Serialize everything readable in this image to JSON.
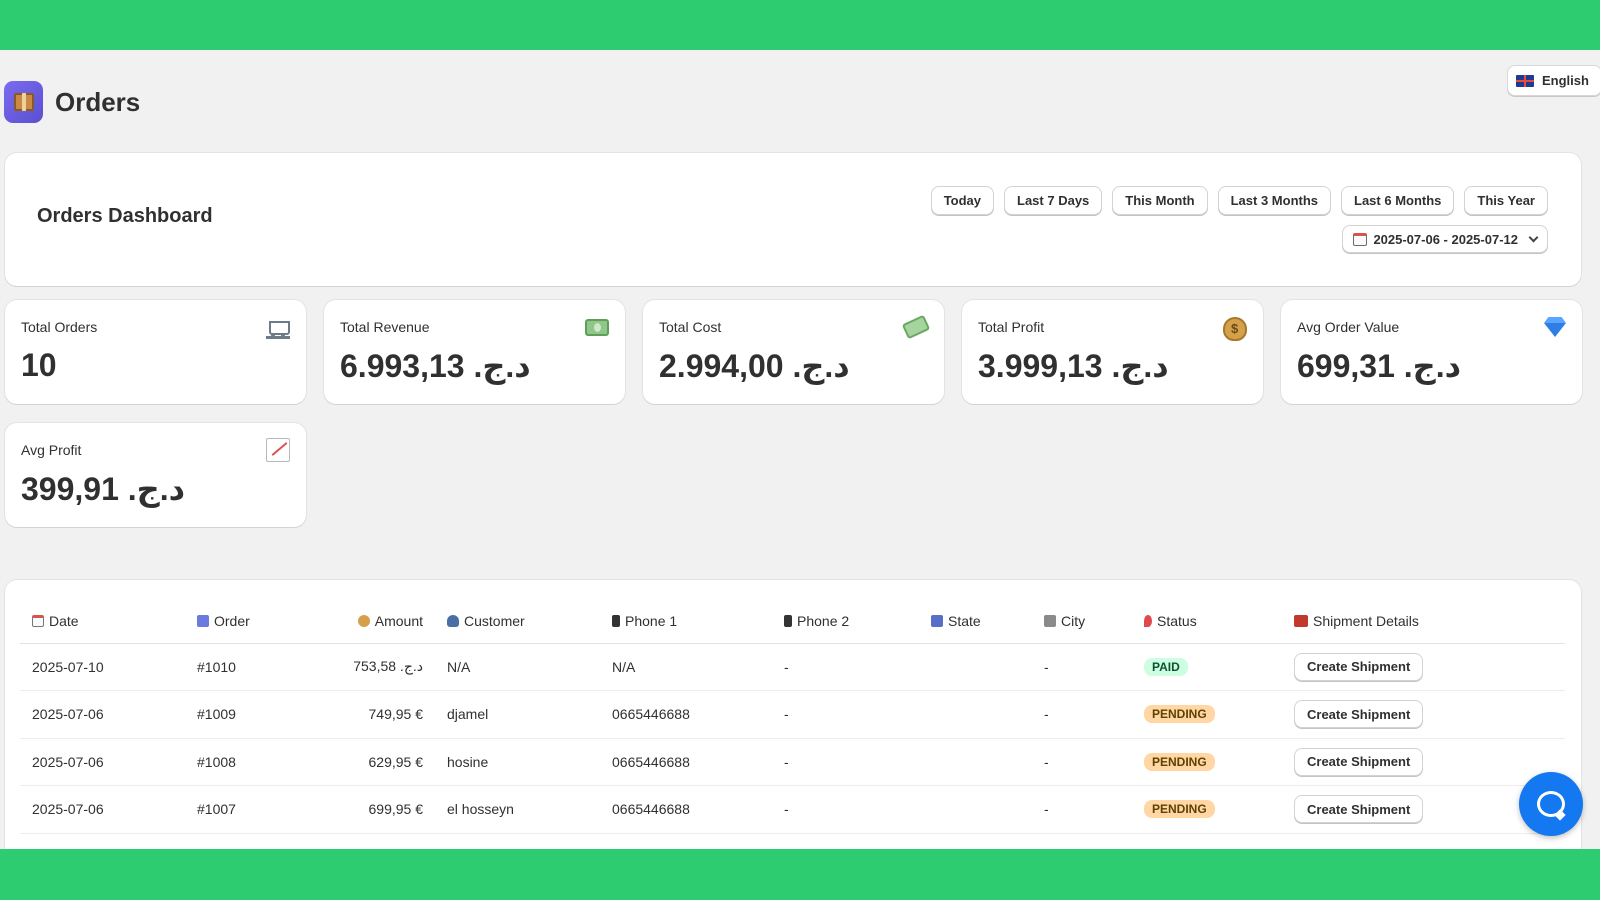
{
  "header": {
    "title": "Orders",
    "app_icon": "package-icon"
  },
  "language": {
    "label": "English",
    "icon": "uk-flag-icon"
  },
  "dashboard": {
    "title": "Orders Dashboard",
    "quick_filters": [
      "Today",
      "Last 7 Days",
      "This Month",
      "Last 3 Months",
      "Last 6 Months",
      "This Year"
    ],
    "date_range": "2025-07-06 - 2025-07-12"
  },
  "metrics": [
    {
      "label": "Total Orders",
      "value": "10",
      "icon": "shopping-cart-icon"
    },
    {
      "label": "Total Revenue",
      "value": "د.ج. 6.993,13",
      "icon": "banknote-icon"
    },
    {
      "label": "Total Cost",
      "value": "د.ج. 2.994,00",
      "icon": "money-with-wings-icon"
    },
    {
      "label": "Total Profit",
      "value": "د.ج. 3.999,13",
      "icon": "money-bag-icon"
    },
    {
      "label": "Avg Order Value",
      "value": "د.ج. 699,31",
      "icon": "gem-icon"
    },
    {
      "label": "Avg Profit",
      "value": "د.ج. 399,91",
      "icon": "chart-increasing-icon"
    }
  ],
  "table": {
    "columns": [
      "Date",
      "Order",
      "Amount",
      "Customer",
      "Phone 1",
      "Phone 2",
      "State",
      "City",
      "Status",
      "Shipment Details"
    ],
    "rows": [
      {
        "date": "2025-07-10",
        "order": "#1010",
        "amount": "د.ج. 753,58",
        "customer": "N/A",
        "phone1": "N/A",
        "phone2": "-",
        "state": "",
        "city": "-",
        "status": "PAID",
        "action": "Create Shipment"
      },
      {
        "date": "2025-07-06",
        "order": "#1009",
        "amount": "749,95 €",
        "customer": "djamel",
        "phone1": "0665446688",
        "phone2": "-",
        "state": "",
        "city": "-",
        "status": "PENDING",
        "action": "Create Shipment"
      },
      {
        "date": "2025-07-06",
        "order": "#1008",
        "amount": "629,95 €",
        "customer": "hosine",
        "phone1": "0665446688",
        "phone2": "-",
        "state": "",
        "city": "-",
        "status": "PENDING",
        "action": "Create Shipment"
      },
      {
        "date": "2025-07-06",
        "order": "#1007",
        "amount": "699,95 €",
        "customer": "el hosseyn",
        "phone1": "0665446688",
        "phone2": "-",
        "state": "",
        "city": "-",
        "status": "PENDING",
        "action": "Create Shipment"
      }
    ]
  },
  "colors": {
    "accent_green": "#2ecc71",
    "chat_blue": "#1478f0",
    "paid_bg": "#cdfee1",
    "pending_bg": "#ffd6a4"
  },
  "chat": {
    "icon": "chat-bubble-icon"
  }
}
